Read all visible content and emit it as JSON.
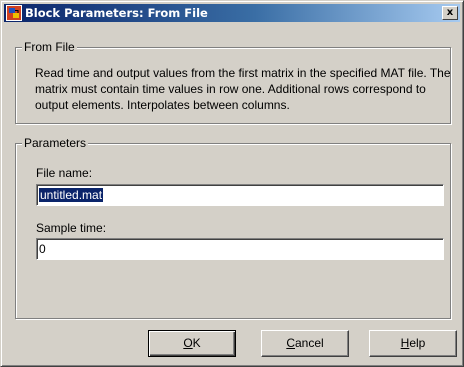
{
  "window": {
    "title": "Block Parameters: From File",
    "close_glyph": "x",
    "icon": "simulink-block-icon"
  },
  "from_file_group": {
    "legend": "From File",
    "description": "Read time and output values from the first matrix in the specified MAT file.  The matrix must contain time values in row one.  Additional rows correspond to output elements.  Interpolates between columns."
  },
  "parameters_group": {
    "legend": "Parameters",
    "file_name_label": "File name:",
    "file_name_value": "untitled.mat",
    "sample_time_label": "Sample time:",
    "sample_time_value": "0"
  },
  "buttons": {
    "ok": {
      "mnemonic": "O",
      "rest": "K"
    },
    "cancel": {
      "mnemonic": "C",
      "rest": "ancel"
    },
    "help": {
      "mnemonic": "H",
      "rest": "elp"
    }
  }
}
